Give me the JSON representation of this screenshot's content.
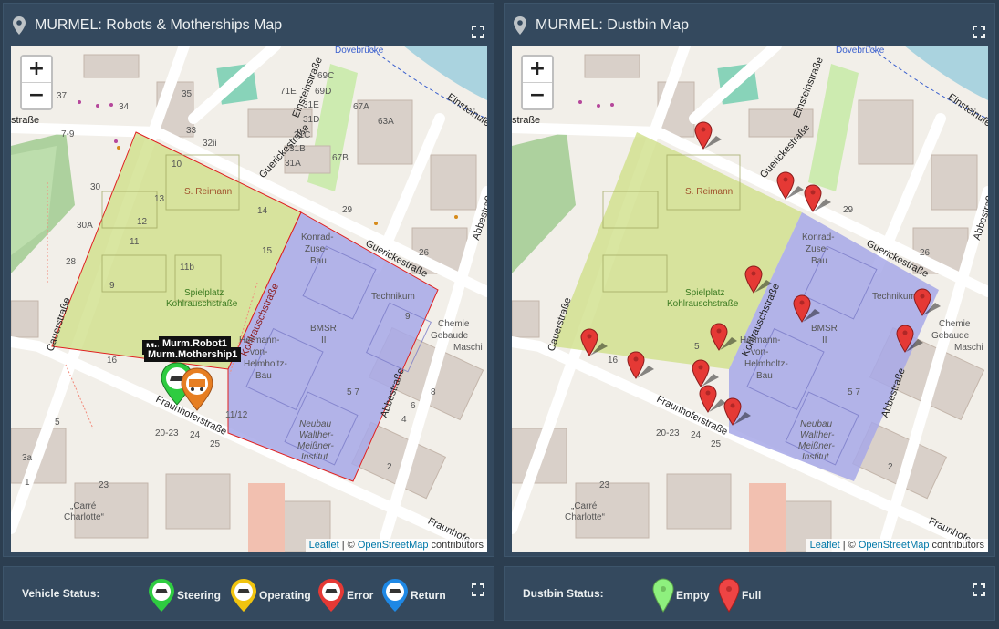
{
  "left_panel": {
    "title": "MURMEL: Robots & Motherships Map",
    "icons": {
      "title": "map-marker-icon",
      "expand": "fullscreen-icon"
    },
    "tooltips": {
      "robot": "Murm.Robot1",
      "mothership": "Murm.Mothership1",
      "robot_prefix": "Mu"
    }
  },
  "right_panel": {
    "title": "MURMEL: Dustbin Map",
    "icons": {
      "title": "map-marker-icon",
      "expand": "fullscreen-icon"
    }
  },
  "map": {
    "zoom_in": "+",
    "zoom_out": "−",
    "attribution": {
      "leaflet": "Leaflet",
      "sep": " | © ",
      "osm": "OpenStreetMap",
      "suffix": " contributors"
    },
    "labels": {
      "dovebrucke": "Dovebrücke",
      "einsteinufer": "Einsteinufer",
      "einsteinstr": "Einsteinstraße",
      "guerickestr1": "Guerickestraße",
      "guerickestr2": "Guerickestraße",
      "abbestr1": "Abbestraße",
      "abbestr2": "Abbestraße",
      "cauerstr": "Cauerstraße",
      "fraunhoferstr1": "Fraunhoferstraße",
      "fraunhoferstr2": "Fraunhofe",
      "kohlrauschstr": "Kohlrauschstraße",
      "strasse": "straße",
      "s_reimann": "S. Reimann",
      "spielplatz": "Spielplatz",
      "spielplatz2": "Kohlrauschstraße",
      "konrad": "Konrad-",
      "zuse": "Zuse-",
      "bau": "Bau",
      "technikum": "Technikum",
      "bmsr": "BMSR",
      "bmsr2": "II",
      "hermann1": "Hermann-",
      "hermann2": "von-",
      "hermann3": "Helmholtz-",
      "hermann4": "Bau",
      "chemie1": "Chemie",
      "chemie2": "Gebaude",
      "chemie3": "Maschi",
      "neubau1": "Neubau",
      "neubau2": "Walther-",
      "neubau3": "Meißner-",
      "neubau4": "Institut",
      "carre1": "„Carré",
      "carre2": "Charlotte“",
      "n37": "37",
      "n34": "34",
      "n79": "7-9",
      "n71e": "71E",
      "n69c": "69C",
      "n69d": "69D",
      "n67a": "67A",
      "n31e": "31E",
      "n31d": "31D",
      "n31c": "31C",
      "n31b": "31B",
      "n31a": "31A",
      "n63a": "63A",
      "n67b": "67B",
      "n32ii": "32ii",
      "n35": "35",
      "n33": "33",
      "n10": "10",
      "n13a": "13",
      "n12": "12",
      "n11": "11",
      "n11b": "11b",
      "n9": "9",
      "n30a": "30A",
      "n30": "30",
      "n28": "28",
      "n14": "14",
      "n15": "15",
      "n16": "16",
      "n26": "26",
      "n2023": "20-23",
      "n24": "24",
      "n25": "25",
      "n23": "23",
      "n3a": "3a",
      "n5": "5",
      "n1": "1",
      "n6": "6",
      "n4": "4",
      "n8": "8",
      "n2": "2",
      "n29": "29",
      "n1112": "11/12",
      "n57": "5 7",
      "n9b": "9",
      "n12b": "12",
      "n13": "13"
    }
  },
  "vehicle_status": {
    "label": "Vehicle Status:",
    "items": [
      {
        "label": "Steering",
        "color": "#2ecc40",
        "icon": "robot-icon"
      },
      {
        "label": "Operating",
        "color": "#f1c40f",
        "icon": "robot-icon"
      },
      {
        "label": "Error",
        "color": "#e53935",
        "icon": "robot-icon"
      },
      {
        "label": "Return",
        "color": "#1e88e5",
        "icon": "robot-icon"
      }
    ]
  },
  "dustbin_status": {
    "label": "Dustbin Status:",
    "items": [
      {
        "label": "Empty",
        "color": "#8ef07e"
      },
      {
        "label": "Full",
        "color": "#ee4444"
      }
    ]
  },
  "colors": {
    "panel_bg": "#34495e",
    "page_bg": "#2c3e50",
    "zone_green": "#cfe08a",
    "zone_blue": "#a7a8e8",
    "zone_border": "#e02020",
    "pin_full": "#e53935",
    "mothership": "#e67e22"
  }
}
